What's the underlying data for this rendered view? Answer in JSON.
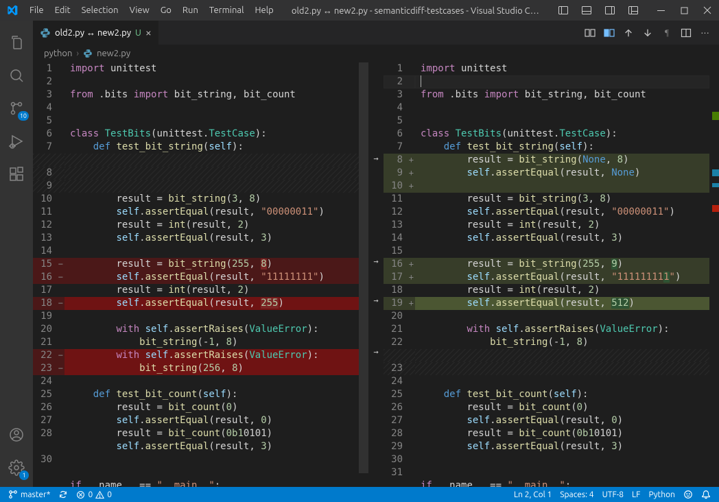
{
  "window": {
    "title": "old2.py ↔ new2.py - semanticdiff-testcases - Visual Studio C…"
  },
  "menu": [
    "File",
    "Edit",
    "Selection",
    "View",
    "Go",
    "Run",
    "Terminal",
    "Help"
  ],
  "activity": {
    "scm_badge": "10",
    "settings_badge": "1"
  },
  "tab": {
    "label": "old2.py ↔ new2.py",
    "status": "U"
  },
  "breadcrumb": {
    "root": "python",
    "file": "new2.py"
  },
  "status": {
    "branch": "master*",
    "sync": "",
    "errors": "0",
    "warnings": "0",
    "ln_col": "Ln 2, Col 1",
    "spaces": "Spaces: 4",
    "encoding": "UTF-8",
    "eol": "LF",
    "language": "Python"
  },
  "left_lines": [
    "1",
    "2",
    "3",
    "4",
    "5",
    "6",
    "7",
    "",
    "8",
    "9",
    "10",
    "11",
    "12",
    "13",
    "14",
    "15",
    "16",
    "17",
    "18",
    "19",
    "20",
    "21",
    "22",
    "23",
    "24",
    "25",
    "26",
    "27",
    "28",
    "",
    "30"
  ],
  "right_lines": [
    "1",
    "2",
    "3",
    "4",
    "5",
    "6",
    "7",
    "8",
    "9",
    "10",
    "11",
    "12",
    "13",
    "14",
    "15",
    "16",
    "17",
    "18",
    "19",
    "20",
    "21",
    "22",
    "",
    "23",
    "24",
    "25",
    "26",
    "27",
    "28",
    "29",
    "30",
    "31"
  ]
}
